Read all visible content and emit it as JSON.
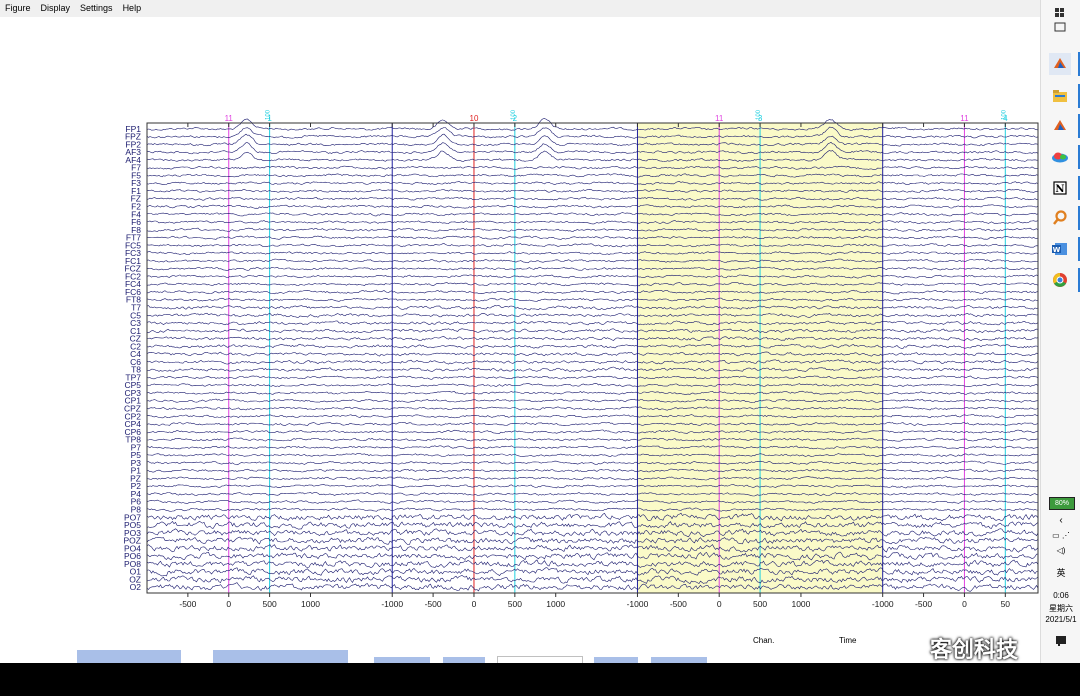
{
  "menu": [
    "Figure",
    "Display",
    "Settings",
    "Help"
  ],
  "channels": [
    "FP1",
    "FPZ",
    "FP2",
    "AF3",
    "AF4",
    "F7",
    "F5",
    "F3",
    "F1",
    "FZ",
    "F2",
    "F4",
    "F6",
    "F8",
    "FT7",
    "FC5",
    "FC3",
    "FC1",
    "FCZ",
    "FC2",
    "FC4",
    "FC6",
    "FT8",
    "T7",
    "C5",
    "C3",
    "C1",
    "CZ",
    "C2",
    "C4",
    "C6",
    "T8",
    "TP7",
    "CP5",
    "CP3",
    "CP1",
    "CPZ",
    "CP2",
    "CP4",
    "CP6",
    "TP8",
    "P7",
    "P5",
    "P3",
    "P1",
    "PZ",
    "P2",
    "P4",
    "P6",
    "P8",
    "PO7",
    "PO5",
    "PO3",
    "POZ",
    "PO4",
    "PO6",
    "PO8",
    "O1",
    "OZ",
    "O2"
  ],
  "x_axis": {
    "ticks": [
      {
        "t": -700,
        "label": "-500"
      },
      {
        "t": -200,
        "label": "0"
      },
      {
        "t": 300,
        "label": "500"
      },
      {
        "t": 800,
        "label": "1000"
      },
      {
        "t": 1800,
        "label": "-1000"
      },
      {
        "t": 2300,
        "label": "-500"
      },
      {
        "t": 2800,
        "label": "0"
      },
      {
        "t": 3300,
        "label": "500"
      },
      {
        "t": 3800,
        "label": "1000"
      },
      {
        "t": 4800,
        "label": "-1000"
      },
      {
        "t": 5300,
        "label": "-500"
      },
      {
        "t": 5800,
        "label": "0"
      },
      {
        "t": 6300,
        "label": "500"
      },
      {
        "t": 6800,
        "label": "1000"
      },
      {
        "t": 7800,
        "label": "-1000"
      },
      {
        "t": 8300,
        "label": "-500"
      },
      {
        "t": 8800,
        "label": "0"
      },
      {
        "t": 9300,
        "label": "50"
      }
    ],
    "range": [
      -1200,
      9700
    ]
  },
  "epoch_boundaries": [
    1800,
    4800,
    7800
  ],
  "highlight_epoch": [
    4800,
    7800
  ],
  "highlight_color": "#fafac8",
  "event_markers": [
    {
      "t": -200,
      "label": "11",
      "color": "#e040e0"
    },
    {
      "t": 300,
      "label": "1",
      "color": "#20d0e0",
      "tag": "100"
    },
    {
      "t": 2800,
      "label": "10",
      "color": "#e02020"
    },
    {
      "t": 3300,
      "label": "2",
      "color": "#20d0e0",
      "tag": "100"
    },
    {
      "t": 5800,
      "label": "11",
      "color": "#e040e0"
    },
    {
      "t": 6300,
      "label": "3",
      "color": "#20d0e0",
      "tag": "100"
    },
    {
      "t": 8800,
      "label": "11",
      "color": "#e040e0"
    },
    {
      "t": 9300,
      "label": "4",
      "color": "#20d0e0",
      "tag": "100"
    }
  ],
  "trace_color": "#1a1a6e",
  "bottom_labels": {
    "chan": "Chan.",
    "time": "Time"
  },
  "watermark": "客创科技",
  "tray": {
    "battery": "80%",
    "ime": "英",
    "time": "0:06",
    "weekday": "星期六",
    "date": "2021/5/1"
  }
}
